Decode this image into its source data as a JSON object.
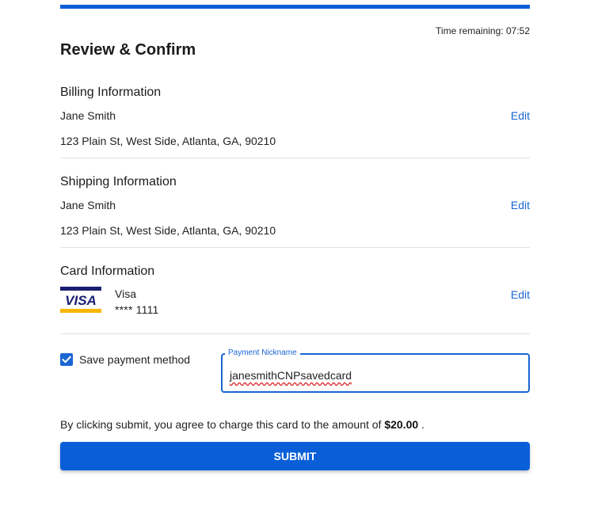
{
  "timer": {
    "label": "Time remaining:",
    "value": "07:52"
  },
  "page": {
    "title": "Review & Confirm"
  },
  "billing": {
    "title": "Billing Information",
    "name": "Jane Smith",
    "address": "123 Plain St, West Side, Atlanta, GA, 90210",
    "edit_label": "Edit"
  },
  "shipping": {
    "title": "Shipping Information",
    "name": "Jane Smith",
    "address": "123 Plain St, West Side, Atlanta, GA, 90210",
    "edit_label": "Edit"
  },
  "card": {
    "title": "Card Information",
    "brand": "Visa",
    "number_masked": "**** 1111",
    "edit_label": "Edit",
    "logo_text": "VISA"
  },
  "save_payment": {
    "label": "Save payment method",
    "checked": true
  },
  "nickname": {
    "legend": "Payment Nickname",
    "value": "janesmithCNPsavedcard"
  },
  "agreement": {
    "text_before": "By clicking submit, you agree to charge this card to the amount of ",
    "amount": "$20.00",
    "text_after": " ."
  },
  "submit": {
    "label": "SUBMIT"
  },
  "colors": {
    "accent": "#0a5fd8",
    "link": "#1a66d2",
    "visa_blue": "#1a1f71",
    "visa_gold": "#f7b600"
  }
}
